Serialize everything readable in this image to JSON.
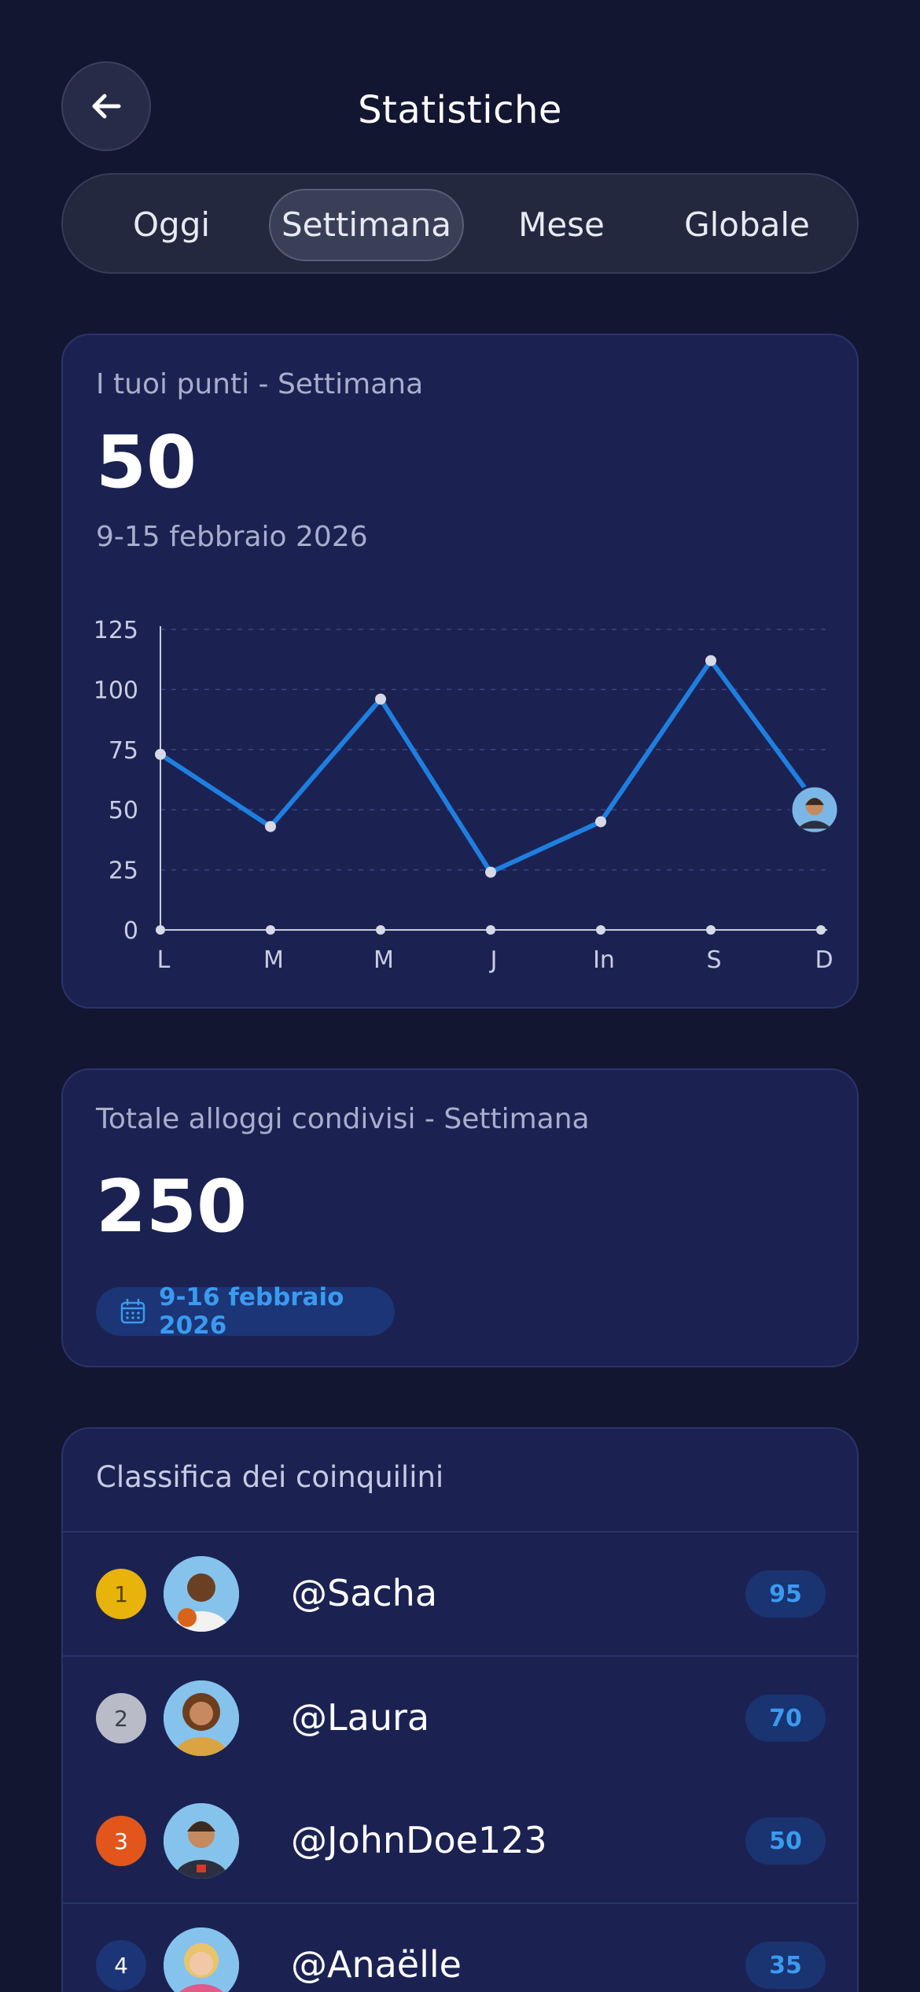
{
  "header": {
    "title": "Statistiche"
  },
  "tabs": [
    {
      "label": "Oggi"
    },
    {
      "label": "Settimana"
    },
    {
      "label": "Mese"
    },
    {
      "label": "Globale"
    }
  ],
  "active_tab": "Settimana",
  "points_card": {
    "label": "I tuoi punti - Settimana",
    "value": "50",
    "date_range": "9-15 febbraio 2026"
  },
  "chart_data": {
    "type": "line",
    "categories": [
      "L",
      "M",
      "M",
      "J",
      "In",
      "S",
      "D"
    ],
    "series": [
      {
        "values": [
          73,
          43,
          96,
          24,
          45,
          112,
          50
        ]
      }
    ],
    "yticks": [
      0,
      25,
      50,
      75,
      100,
      125
    ],
    "ylim": [
      0,
      125
    ],
    "grid": true,
    "line_color": "#1e7fe0",
    "last_point_marker": "avatar"
  },
  "shared_card": {
    "label": "Totale alloggi condivisi - Settimana",
    "value": "250",
    "date_range": "9-16 febbraio 2026",
    "date_icon": "calendar-icon"
  },
  "leaderboard": {
    "title": "Classifica dei coinquilini",
    "rows": [
      {
        "rank": "1",
        "username": "@Sacha",
        "score": "95",
        "rank_color": "#e8b30a"
      },
      {
        "rank": "2",
        "username": "@Laura",
        "score": "70",
        "rank_color": "#b9bcc7"
      },
      {
        "rank": "3",
        "username": "@JohnDoe123",
        "score": "50",
        "rank_color": "#e2561b"
      },
      {
        "rank": "4",
        "username": "@Anaëlle",
        "score": "35",
        "rank_color": "#1b3576"
      }
    ]
  },
  "colors": {
    "background": "#121631",
    "card": "#1b2252",
    "accent": "#1e7fe0"
  }
}
